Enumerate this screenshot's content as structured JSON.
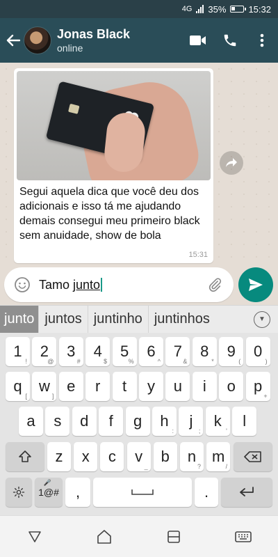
{
  "status_bar": {
    "network": "4G",
    "battery": "35%",
    "time": "15:32"
  },
  "header": {
    "name": "Jonas Black",
    "status": "online"
  },
  "message": {
    "caption": "Segui aquela dica que você deu dos adicionais e isso tá me ajudando demais consegui meu primeiro black sem anuidade, show de bola",
    "time": "15:31"
  },
  "input": {
    "prefix": "Tamo ",
    "current_word": "junto"
  },
  "suggestions": [
    "junto",
    "juntos",
    "juntinho",
    "juntinhos"
  ],
  "keyboard": {
    "row1": [
      {
        "k": "1",
        "s": "!"
      },
      {
        "k": "2",
        "s": "@"
      },
      {
        "k": "3",
        "s": "#"
      },
      {
        "k": "4",
        "s": "$"
      },
      {
        "k": "5",
        "s": "%"
      },
      {
        "k": "6",
        "s": "^"
      },
      {
        "k": "7",
        "s": "&"
      },
      {
        "k": "8",
        "s": "*"
      },
      {
        "k": "9",
        "s": "("
      },
      {
        "k": "0",
        "s": ")"
      }
    ],
    "row2": [
      {
        "k": "q",
        "s": "["
      },
      {
        "k": "w",
        "s": "]"
      },
      {
        "k": "e",
        "s": ""
      },
      {
        "k": "r",
        "s": ""
      },
      {
        "k": "t",
        "s": ""
      },
      {
        "k": "y",
        "s": ""
      },
      {
        "k": "u",
        "s": ""
      },
      {
        "k": "i",
        "s": ""
      },
      {
        "k": "o",
        "s": ""
      },
      {
        "k": "p",
        "s": "+"
      }
    ],
    "row3": [
      {
        "k": "a",
        "s": ""
      },
      {
        "k": "s",
        "s": ""
      },
      {
        "k": "d",
        "s": ""
      },
      {
        "k": "f",
        "s": ""
      },
      {
        "k": "g",
        "s": ""
      },
      {
        "k": "h",
        "s": ":"
      },
      {
        "k": "j",
        "s": ";"
      },
      {
        "k": "k",
        "s": "'"
      },
      {
        "k": "l",
        "s": ""
      }
    ],
    "row4": [
      {
        "k": "z",
        "s": ""
      },
      {
        "k": "x",
        "s": ""
      },
      {
        "k": "c",
        "s": ""
      },
      {
        "k": "v",
        "s": "_"
      },
      {
        "k": "b",
        "s": ""
      },
      {
        "k": "n",
        "s": "?"
      },
      {
        "k": "m",
        "s": "/"
      }
    ],
    "symbols_label": "1@#",
    "comma_label": ",",
    "period_label": "."
  },
  "colors": {
    "header": "#2a4d58",
    "send": "#078a7e",
    "caret": "#1a9988"
  }
}
